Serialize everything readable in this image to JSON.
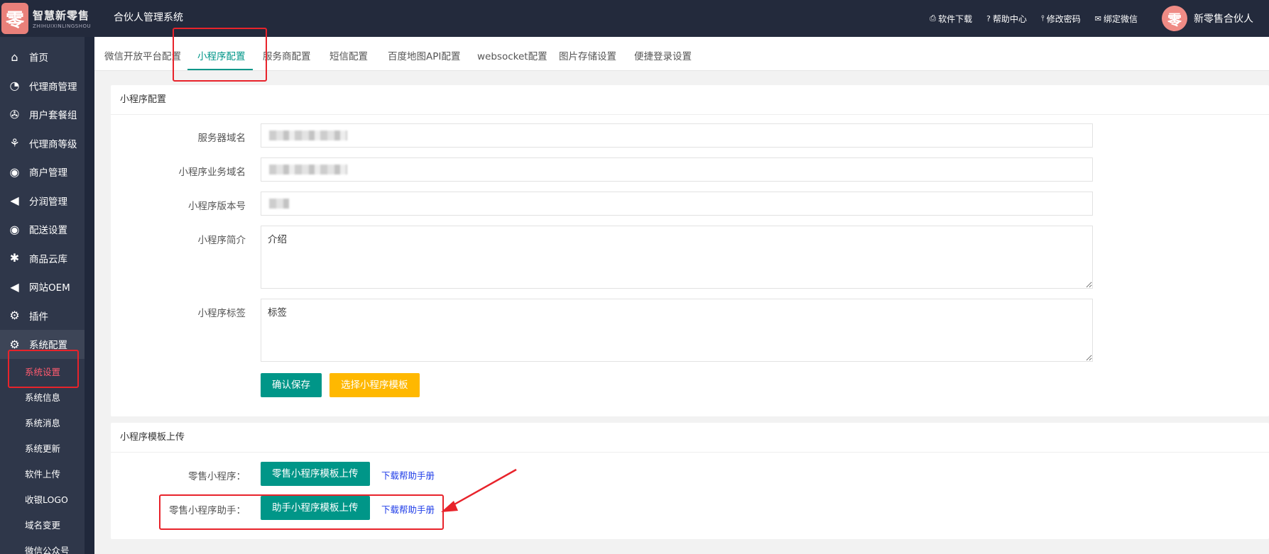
{
  "app": {
    "logo_glyph": "零",
    "logo_cn": "智慧新零售",
    "logo_en": "ZHIHUIXINLINGSHOU",
    "title": "合伙人管理系统"
  },
  "header": {
    "links": [
      {
        "icon": "printer-icon",
        "glyph": "⎙",
        "label": "软件下载"
      },
      {
        "icon": "help-icon",
        "glyph": "?",
        "label": "帮助中心"
      },
      {
        "icon": "thermometer-icon",
        "glyph": "⫯",
        "label": "修改密码"
      },
      {
        "icon": "chat-icon",
        "glyph": "✉",
        "label": "绑定微信"
      }
    ],
    "avatar_glyph": "零",
    "user_name": "新零售合伙人"
  },
  "sidebar": {
    "items": [
      {
        "icon": "home-icon",
        "glyph": "⌂",
        "label": "首页"
      },
      {
        "icon": "agent-icon",
        "glyph": "◔",
        "label": "代理商管理"
      },
      {
        "icon": "package-icon",
        "glyph": "✇",
        "label": "用户套餐组"
      },
      {
        "icon": "tree-icon",
        "glyph": "⚘",
        "label": "代理商等级"
      },
      {
        "icon": "user-icon",
        "glyph": "◉",
        "label": "商户管理"
      },
      {
        "icon": "send-icon",
        "glyph": "◀",
        "label": "分润管理"
      },
      {
        "icon": "user-circle-icon",
        "glyph": "◉",
        "label": "配送设置"
      },
      {
        "icon": "asterisk-icon",
        "glyph": "✱",
        "label": "商品云库"
      },
      {
        "icon": "send-icon",
        "glyph": "◀",
        "label": "网站OEM"
      },
      {
        "icon": "cogs-icon",
        "glyph": "⚙",
        "label": "插件"
      },
      {
        "icon": "cogs-icon",
        "glyph": "⚙",
        "label": "系统配置"
      }
    ],
    "sub_items": [
      {
        "label": "系统设置",
        "active": true
      },
      {
        "label": "系统信息"
      },
      {
        "label": "系统消息"
      },
      {
        "label": "系统更新"
      },
      {
        "label": "软件上传"
      },
      {
        "label": "收银LOGO"
      },
      {
        "label": "域名变更"
      },
      {
        "label": "微信公众号"
      }
    ]
  },
  "tabs": [
    {
      "label": "微信开放平台配置"
    },
    {
      "label": "小程序配置",
      "active": true
    },
    {
      "label": "服务商配置"
    },
    {
      "label": "短信配置"
    },
    {
      "label": "百度地图API配置"
    },
    {
      "label": "websocket配置"
    },
    {
      "label": "图片存储设置"
    },
    {
      "label": "便捷登录设置"
    }
  ],
  "config_panel": {
    "title": "小程序配置",
    "fields": {
      "server_domain": {
        "label": "服务器域名",
        "value": ""
      },
      "business_domain": {
        "label": "小程序业务域名",
        "value": ""
      },
      "version": {
        "label": "小程序版本号",
        "value": ""
      },
      "intro": {
        "label": "小程序简介",
        "value": "介绍"
      },
      "tags": {
        "label": "小程序标签",
        "value": "标签"
      }
    },
    "save_label": "确认保存",
    "choose_template_label": "选择小程序模板"
  },
  "upload_panel": {
    "title": "小程序模板上传",
    "rows": [
      {
        "label": "零售小程序：",
        "button": "零售小程序模板上传",
        "link": "下载帮助手册"
      },
      {
        "label": "零售小程序助手：",
        "button": "助手小程序模板上传",
        "link": "下载帮助手册"
      }
    ]
  },
  "colors": {
    "header_bg": "#232a3c",
    "sidebar_bg": "#2f374a",
    "accent": "#009688",
    "warning": "#ffb800",
    "annotation": "#e8232b"
  }
}
